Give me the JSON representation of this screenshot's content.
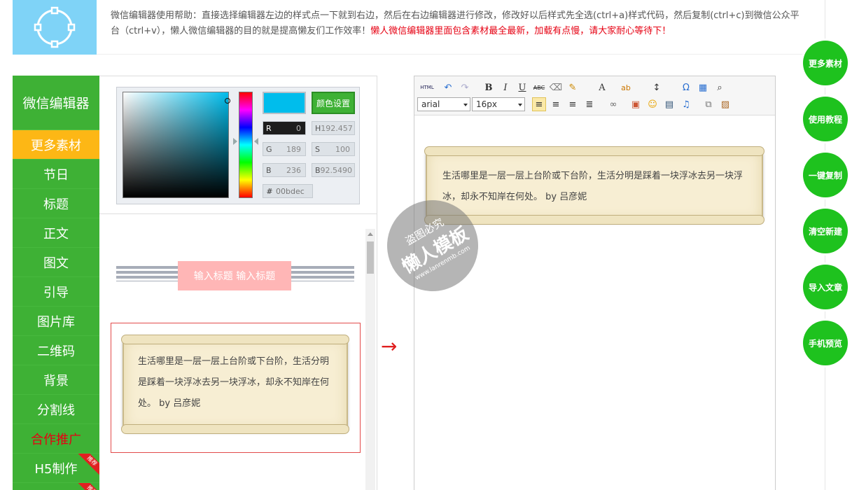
{
  "header": {
    "help_text": "微信编辑器使用帮助：直接选择编辑器左边的样式点一下就到右边，然后在右边编辑器进行修改，修改好以后样式先全选(ctrl+a)样式代码，然后复制(ctrl+c)到微信公众平台（ctrl+v），懒人微信编辑器的目的就是提高懒友们工作效率！",
    "notice": "懒人微信编辑器里面包含素材最全最新，加载有点慢，请大家耐心等待下！",
    "logo_icon": "circle-nodes-icon"
  },
  "sidebar": {
    "brand": "微信编辑器",
    "items": [
      {
        "label": "更多素材"
      },
      {
        "label": "节日"
      },
      {
        "label": "标题"
      },
      {
        "label": "正文"
      },
      {
        "label": "图文"
      },
      {
        "label": "引导"
      },
      {
        "label": "图片库"
      },
      {
        "label": "二维码"
      },
      {
        "label": "背景"
      },
      {
        "label": "分割线"
      },
      {
        "label": "合作推广"
      },
      {
        "label": "H5制作",
        "badge": "推荐"
      },
      {
        "label": "",
        "badge": "推荐"
      }
    ]
  },
  "color_picker": {
    "button": "颜色设置",
    "selected_color": "#00bdec",
    "r_label": "R",
    "r_value": "0",
    "g_label": "G",
    "g_value": "189",
    "b_label": "B",
    "b_value": "236",
    "h_label": "H",
    "h_value": "192.457",
    "s_label": "S",
    "s_value": "100",
    "b2_label": "B",
    "b2_value": "92.5490",
    "hex_label": "#",
    "hex_value": "00bdec"
  },
  "templates": {
    "title_sample": "输入标题 输入标题",
    "scroll_text": "生活哪里是一层一层上台阶或下台阶，生活分明是踩着一块浮冰去另一块浮冰，却永不知岸在何处。 by 吕彦妮"
  },
  "editor": {
    "toolbar": {
      "html": "HTML",
      "bold": "B",
      "italic": "I",
      "underline": "U",
      "strike": "ABC",
      "font_color": "A",
      "font_family": "arial",
      "font_size": "16px"
    },
    "content": "生活哪里是一层一层上台阶或下台阶，生活分明是踩着一块浮冰去另一块浮冰，却永不知岸在何处。 by 吕彦妮"
  },
  "watermark": {
    "line1": "盗图必究",
    "line2": "懒人模板",
    "line3": "www.lanrenmb.com"
  },
  "right_buttons": [
    {
      "label": "更多素材"
    },
    {
      "label": "使用教程"
    },
    {
      "label": "一键复制"
    },
    {
      "label": "清空新建"
    },
    {
      "label": "导入文章"
    },
    {
      "label": "手机预览"
    }
  ],
  "colors": {
    "green": "#3eb135",
    "active": "#fdb715",
    "accent": "#e60012",
    "circle_button": "#1ec21e"
  }
}
